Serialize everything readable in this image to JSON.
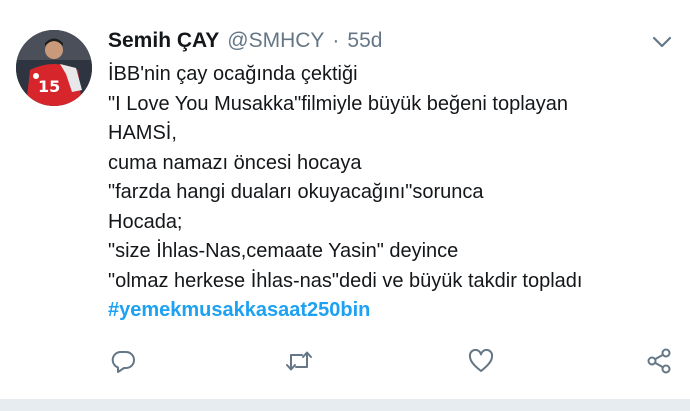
{
  "tweet": {
    "author_name": "Semih ÇAY",
    "author_handle": "@SMHCY",
    "separator": "·",
    "time": "55d",
    "lines": [
      "İBB'nin çay ocağında çektiği",
      "\"I Love You Musakka\"filmiyle büyük beğeni toplayan",
      "HAMSİ,",
      "cuma namazı öncesi hocaya",
      "\"farzda hangi duaları okuyacağını\"sorunca",
      "Hocada;",
      "\"size İhlas-Nas,cemaate Yasin\" deyince",
      "\"olmaz herkese İhlas-nas\"dedi ve büyük takdir topladı"
    ],
    "hashtag": "#yemekmusakkasaat250bin"
  },
  "icons": {
    "caret": "chevron-down-icon",
    "reply": "reply-icon",
    "retweet": "retweet-icon",
    "like": "heart-icon",
    "share": "share-icon"
  },
  "colors": {
    "text": "#14171a",
    "secondary": "#657786",
    "link": "#1da1f2",
    "divider": "#e6ecf0"
  }
}
